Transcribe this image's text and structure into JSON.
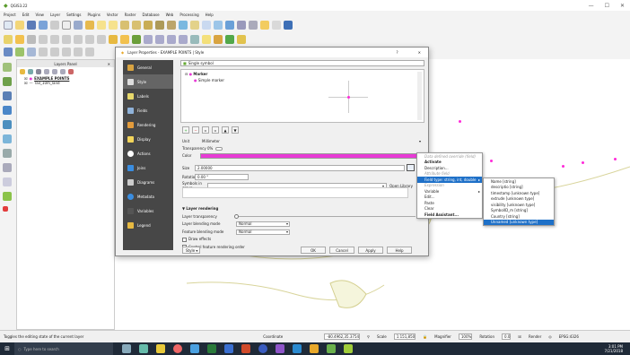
{
  "window": {
    "title": "QGIS3.22"
  },
  "menubar": [
    "Project",
    "Edit",
    "View",
    "Layer",
    "Settings",
    "Plugins",
    "Vector",
    "Raster",
    "Database",
    "Web",
    "Processing",
    "Help"
  ],
  "layers_panel": {
    "title": "Layers Panel",
    "layers": [
      "EXAMPLE POINTS",
      "rail_10m_land"
    ]
  },
  "dialog": {
    "title": "Layer Properties - EXAMPLE POINTS | Style",
    "help": "?",
    "close": "✕",
    "nav": [
      "General",
      "Style",
      "Labels",
      "Fields",
      "Rendering",
      "Display",
      "Actions",
      "Joins",
      "Diagrams",
      "Metadata",
      "Variables",
      "Legend"
    ],
    "renderer": "Single symbol",
    "tree": {
      "marker": "Marker",
      "simple": "Simple marker"
    },
    "unit_label": "Unit",
    "unit_value": "Millimeter",
    "transparency_label": "Transparency 0%",
    "color_label": "Color",
    "color": "#e83ad6",
    "size_label": "Size",
    "size_value": "2.00000",
    "rotation_label": "Rotation",
    "rotation_value": "0.00 °",
    "symbols_label": "Symbols in group",
    "open_library": "Open Library",
    "layer_rendering": {
      "header": "Layer rendering",
      "transparency": "Layer transparency",
      "blending": "Layer blending mode",
      "feature_blending": "Feature blending mode",
      "blend_value": "Normal",
      "feature_value": "Normal",
      "effects": "Draw effects",
      "control_order": "Control feature rendering order"
    },
    "style_btn": "Style",
    "ok": "OK",
    "cancel": "Cancel",
    "apply": "Apply",
    "help_btn": "Help"
  },
  "context_menu": [
    "Data defined override (field)",
    "Activate",
    "Description...",
    "Attribute field",
    "Field type: string, int, double",
    "Expression",
    "Variable",
    "Edit...",
    "Paste",
    "Clear",
    "Field Assistant..."
  ],
  "fields_menu": [
    "Name   [string]",
    "descriptio  [string]",
    "timestamp  [unknown type]",
    "extrude  [unknown type]",
    "visibility  [unknown type]",
    "SymbolID_m  [string]",
    "Country  [string]",
    "Unnamed  [unknown type]"
  ],
  "status": {
    "hint": "Toggles the editing state of the current layer",
    "coord_label": "Coordinate",
    "coord": "-80.4962,35.3754",
    "scale_label": "Scale",
    "scale": "1:151,850",
    "magnifier_label": "Magnifier",
    "magnifier": "100%",
    "rotation_label": "Rotation",
    "rotation": "0.0",
    "render": "Render",
    "crs": "EPSG:4326"
  },
  "taskbar": {
    "search": "Type here to search",
    "time": "3:01 PM",
    "date": "7/21/2018"
  }
}
